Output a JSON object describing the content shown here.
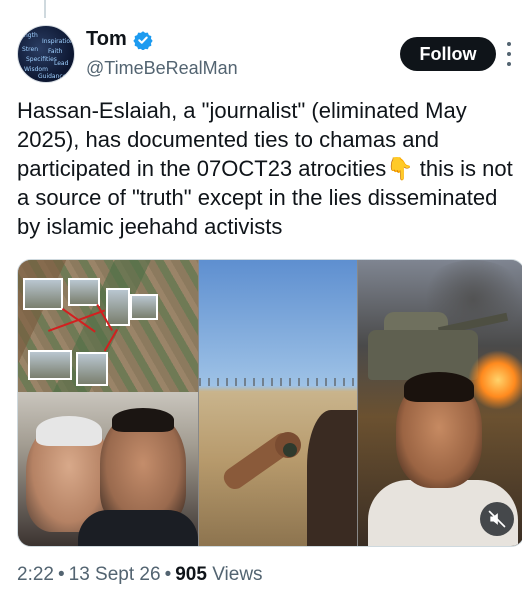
{
  "author": {
    "display_name": "Tom",
    "handle": "@TimeBeRealMan",
    "verified": true,
    "avatar_text": [
      "ngth",
      "Inspiration",
      "Stren",
      "Faith",
      "Specifities",
      "Lead",
      "Wisdom",
      "Guidance"
    ]
  },
  "actions": {
    "follow_label": "Follow",
    "more_icon": "more-vertical-icon"
  },
  "tweet": {
    "text": "Hassan-Eslaiah, a \"journalist\" (eliminated May 2025), has documented ties to chamas and participated in the 07OCT23 atrocities👇 this is not a source of \"truth\" except in the lies disseminated by islamic jeehahd activists"
  },
  "media": {
    "mute_icon": "volume-muted-icon"
  },
  "meta": {
    "time": "2:22",
    "date": "13 Sept 26",
    "separator": "•",
    "views_count": "905",
    "views_label": "Views"
  },
  "colors": {
    "text": "#0f1419",
    "secondary": "#536471",
    "verified": "#1d9bf0",
    "button_bg": "#0f1419",
    "border": "#cfd9de"
  }
}
